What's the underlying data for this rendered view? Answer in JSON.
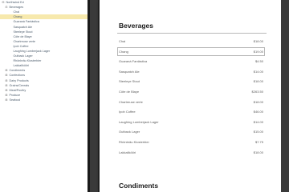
{
  "sidebar": {
    "items": [
      {
        "label": "Northwind Ed",
        "level": 0,
        "expander": "⊟",
        "selected": false
      },
      {
        "label": "Beverages",
        "level": 1,
        "expander": "⊟",
        "selected": false
      },
      {
        "label": "Chai",
        "level": 2,
        "expander": "",
        "selected": false
      },
      {
        "label": "Chang",
        "level": 2,
        "expander": "",
        "selected": true
      },
      {
        "label": "Guaraná Fantástica",
        "level": 2,
        "expander": "",
        "selected": false
      },
      {
        "label": "Sasquatch Ale",
        "level": 2,
        "expander": "",
        "selected": false
      },
      {
        "label": "Steeleye Stout",
        "level": 2,
        "expander": "",
        "selected": false
      },
      {
        "label": "Côte de Blaye",
        "level": 2,
        "expander": "",
        "selected": false
      },
      {
        "label": "Chartreuse verte",
        "level": 2,
        "expander": "",
        "selected": false
      },
      {
        "label": "Ipoh Coffee",
        "level": 2,
        "expander": "",
        "selected": false
      },
      {
        "label": "Laughing Lumberjack Lager",
        "level": 2,
        "expander": "",
        "selected": false
      },
      {
        "label": "Outback Lager",
        "level": 2,
        "expander": "",
        "selected": false
      },
      {
        "label": "Rhönbräu Klosterbier",
        "level": 2,
        "expander": "",
        "selected": false
      },
      {
        "label": "Lakkalikööri",
        "level": 2,
        "expander": "",
        "selected": false
      },
      {
        "label": "Condiments",
        "level": 1,
        "expander": "⊞",
        "selected": false
      },
      {
        "label": "Confections",
        "level": 1,
        "expander": "⊞",
        "selected": false
      },
      {
        "label": "Dairy Products",
        "level": 1,
        "expander": "⊞",
        "selected": false
      },
      {
        "label": "Grains/Cereals",
        "level": 1,
        "expander": "⊞",
        "selected": false
      },
      {
        "label": "Meat/Poultry",
        "level": 1,
        "expander": "⊞",
        "selected": false
      },
      {
        "label": "Produce",
        "level": 1,
        "expander": "⊞",
        "selected": false
      },
      {
        "label": "Seafood",
        "level": 1,
        "expander": "⊞",
        "selected": false
      }
    ]
  },
  "page": {
    "section_beverages": "Beverages",
    "section_condiments": "Condiments",
    "products": [
      {
        "name": "Chai",
        "price": "$18.00",
        "selected": false
      },
      {
        "name": "Chang",
        "price": "$19.00",
        "selected": true
      },
      {
        "name": "Guaraná Fantástica",
        "price": "$4.50",
        "selected": false
      },
      {
        "name": "Sasquatch Ale",
        "price": "$14.00",
        "selected": false
      },
      {
        "name": "Steeleye Stout",
        "price": "$18.00",
        "selected": false
      },
      {
        "name": "Côte de Blaye",
        "price": "$263.50",
        "selected": false
      },
      {
        "name": "Chartreuse verte",
        "price": "$18.00",
        "selected": false
      },
      {
        "name": "Ipoh Coffee",
        "price": "$46.00",
        "selected": false
      },
      {
        "name": "Laughing Lumberjack Lager",
        "price": "$14.00",
        "selected": false
      },
      {
        "name": "Outback Lager",
        "price": "$15.00",
        "selected": false
      },
      {
        "name": "Rhönbräu Klosterbier",
        "price": "$7.75",
        "selected": false
      },
      {
        "name": "Lakkalikööri",
        "price": "$18.00",
        "selected": false
      }
    ]
  }
}
